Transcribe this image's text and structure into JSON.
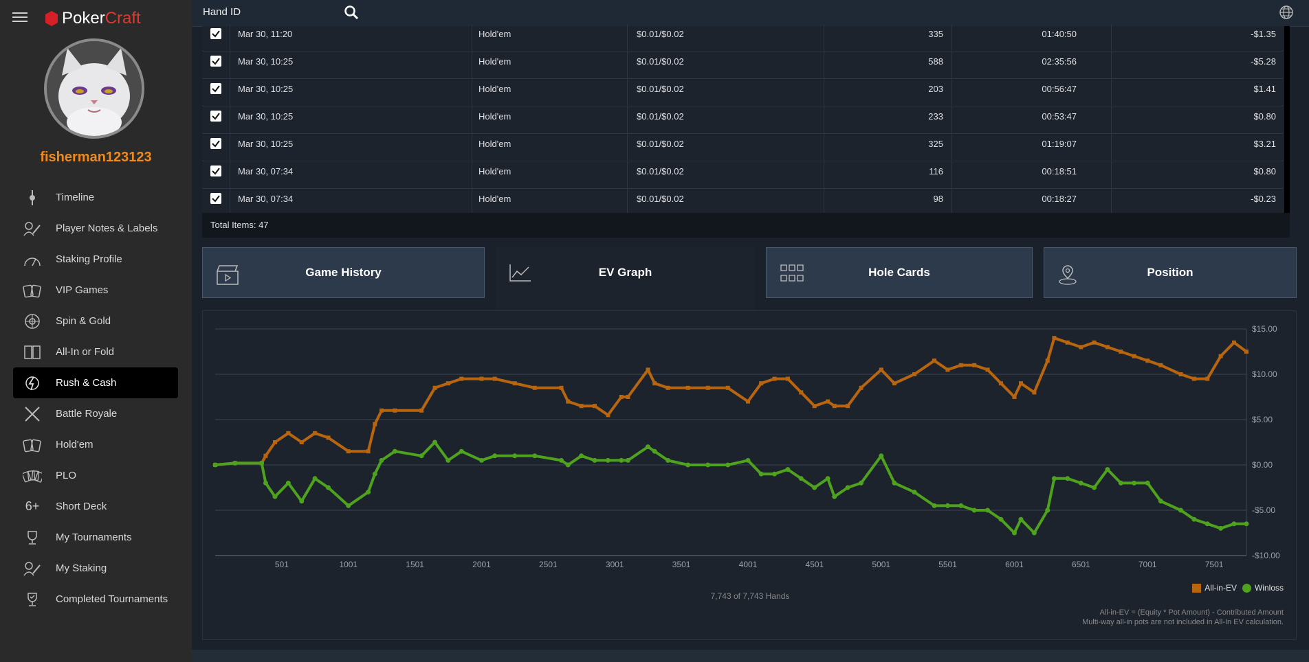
{
  "app": {
    "brand_part1": "Poker",
    "brand_part2": "Craft",
    "username": "fisherman123123"
  },
  "topbar": {
    "hand_id_label": "Hand ID"
  },
  "sidebar": {
    "items": [
      {
        "label": "Timeline",
        "icon": "timeline-icon",
        "active": false
      },
      {
        "label": "Player Notes & Labels",
        "icon": "player-notes-icon",
        "active": false
      },
      {
        "label": "Staking Profile",
        "icon": "staking-profile-icon",
        "active": false
      },
      {
        "label": "VIP Games",
        "icon": "vip-cards-icon",
        "active": false
      },
      {
        "label": "Spin & Gold",
        "icon": "spin-gold-icon",
        "active": false
      },
      {
        "label": "All-In or Fold",
        "icon": "allin-fold-icon",
        "active": false
      },
      {
        "label": "Rush & Cash",
        "icon": "rush-cash-icon",
        "active": true
      },
      {
        "label": "Battle Royale",
        "icon": "battle-royale-icon",
        "active": false
      },
      {
        "label": "Hold'em",
        "icon": "holdem-cards-icon",
        "active": false
      },
      {
        "label": "PLO",
        "icon": "plo-cards-icon",
        "active": false
      },
      {
        "label": "Short Deck",
        "icon": "short-deck-icon",
        "active": false
      },
      {
        "label": "My Tournaments",
        "icon": "trophy-icon",
        "active": false
      },
      {
        "label": "My Staking",
        "icon": "my-staking-icon",
        "active": false
      },
      {
        "label": "Completed Tournaments",
        "icon": "completed-trophy-icon",
        "active": false
      }
    ]
  },
  "table": {
    "rows": [
      {
        "date": "Mar 30, 11:20",
        "game": "Hold'em",
        "stakes": "$0.01/$0.02",
        "hands": "335",
        "duration": "01:40:50",
        "result": "-$1.35"
      },
      {
        "date": "Mar 30, 10:25",
        "game": "Hold'em",
        "stakes": "$0.01/$0.02",
        "hands": "588",
        "duration": "02:35:56",
        "result": "-$5.28"
      },
      {
        "date": "Mar 30, 10:25",
        "game": "Hold'em",
        "stakes": "$0.01/$0.02",
        "hands": "203",
        "duration": "00:56:47",
        "result": "$1.41"
      },
      {
        "date": "Mar 30, 10:25",
        "game": "Hold'em",
        "stakes": "$0.01/$0.02",
        "hands": "233",
        "duration": "00:53:47",
        "result": "$0.80"
      },
      {
        "date": "Mar 30, 10:25",
        "game": "Hold'em",
        "stakes": "$0.01/$0.02",
        "hands": "325",
        "duration": "01:19:07",
        "result": "$3.21"
      },
      {
        "date": "Mar 30, 07:34",
        "game": "Hold'em",
        "stakes": "$0.01/$0.02",
        "hands": "116",
        "duration": "00:18:51",
        "result": "$0.80"
      },
      {
        "date": "Mar 30, 07:34",
        "game": "Hold'em",
        "stakes": "$0.01/$0.02",
        "hands": "98",
        "duration": "00:18:27",
        "result": "-$0.23"
      }
    ],
    "total_items": "Total Items: 47"
  },
  "tabs": [
    {
      "label": "Game History",
      "icon": "game-history-icon",
      "active": false
    },
    {
      "label": "EV Graph",
      "icon": "ev-graph-icon",
      "active": true
    },
    {
      "label": "Hole Cards",
      "icon": "hole-cards-grid-icon",
      "active": false
    },
    {
      "label": "Position",
      "icon": "position-pin-icon",
      "active": false
    }
  ],
  "graph": {
    "hands_count": "7,743 of 7,743 Hands",
    "footnote_line1": "All-in-EV = (Equity * Pot Amount) - Contributed Amount",
    "footnote_line2": "Multi-way all-in pots are not included in All-In EV calculation."
  },
  "chart_data": {
    "type": "line",
    "xlabel": "",
    "ylabel": "",
    "xlim": [
      1,
      7743
    ],
    "ylim": [
      -10,
      15
    ],
    "x_ticks": [
      "501",
      "1001",
      "1501",
      "2001",
      "2501",
      "3001",
      "3501",
      "4001",
      "4501",
      "5001",
      "5501",
      "6001",
      "6501",
      "7001",
      "7501"
    ],
    "x_tick_values": [
      501,
      1001,
      1501,
      2001,
      2501,
      3001,
      3501,
      4001,
      4501,
      5001,
      5501,
      6001,
      6501,
      7001,
      7501
    ],
    "y_ticks": [
      "$15.00",
      "$10.00",
      "$5.00",
      "$0.00",
      "-$5.00",
      "-$10.00"
    ],
    "y_tick_values": [
      15,
      10,
      5,
      0,
      -5,
      -10
    ],
    "grid": true,
    "legend_position": "bottom-right",
    "series": [
      {
        "name": "All-in-EV",
        "color": "#b8650f",
        "x": [
          1,
          150,
          350,
          380,
          450,
          550,
          650,
          750,
          850,
          1001,
          1150,
          1200,
          1250,
          1350,
          1550,
          1650,
          1750,
          1850,
          2001,
          2100,
          2250,
          2400,
          2600,
          2650,
          2750,
          2850,
          2950,
          3050,
          3100,
          3250,
          3300,
          3400,
          3550,
          3700,
          3850,
          4001,
          4100,
          4200,
          4300,
          4400,
          4500,
          4600,
          4650,
          4750,
          4850,
          5001,
          5100,
          5250,
          5400,
          5500,
          5600,
          5700,
          5800,
          5900,
          6001,
          6050,
          6150,
          6250,
          6300,
          6400,
          6500,
          6600,
          6700,
          6800,
          6900,
          7001,
          7100,
          7250,
          7350,
          7450,
          7550,
          7650,
          7743
        ],
        "y": [
          0,
          0.2,
          0.2,
          1,
          2.5,
          3.5,
          2.5,
          3.5,
          3,
          1.5,
          1.5,
          4.5,
          6,
          6,
          6,
          8.5,
          9,
          9.5,
          9.5,
          9.5,
          9,
          8.5,
          8.5,
          7,
          6.5,
          6.5,
          5.5,
          7.5,
          7.5,
          10.5,
          9,
          8.5,
          8.5,
          8.5,
          8.5,
          7,
          9,
          9.5,
          9.5,
          8,
          6.5,
          7,
          6.5,
          6.5,
          8.5,
          10.5,
          9,
          10,
          11.5,
          10.5,
          11,
          11,
          10.5,
          9,
          7.5,
          9,
          8,
          11.5,
          14,
          13.5,
          13,
          13.5,
          13,
          12.5,
          12,
          11.5,
          11,
          10,
          9.5,
          9.5,
          12,
          13.5,
          12.5
        ]
      },
      {
        "name": "Winloss",
        "color": "#4ea21e",
        "x": [
          1,
          150,
          350,
          380,
          450,
          550,
          650,
          750,
          850,
          1001,
          1150,
          1200,
          1250,
          1350,
          1550,
          1650,
          1750,
          1850,
          2001,
          2100,
          2250,
          2400,
          2600,
          2650,
          2750,
          2850,
          2950,
          3050,
          3100,
          3250,
          3300,
          3400,
          3550,
          3700,
          3850,
          4001,
          4100,
          4200,
          4300,
          4400,
          4500,
          4600,
          4650,
          4750,
          4850,
          5001,
          5100,
          5250,
          5400,
          5500,
          5600,
          5700,
          5800,
          5900,
          6001,
          6050,
          6150,
          6250,
          6300,
          6400,
          6500,
          6600,
          6700,
          6800,
          6900,
          7001,
          7100,
          7250,
          7350,
          7450,
          7550,
          7650,
          7743
        ],
        "y": [
          0,
          0.2,
          0.2,
          -2,
          -3.5,
          -2,
          -4,
          -1.5,
          -2.5,
          -4.5,
          -3,
          -1,
          0.5,
          1.5,
          1,
          2.5,
          0.5,
          1.5,
          0.5,
          1,
          1,
          1,
          0.5,
          0,
          1,
          0.5,
          0.5,
          0.5,
          0.5,
          2,
          1.5,
          0.5,
          0,
          0,
          0,
          0.5,
          -1,
          -1,
          -0.5,
          -1.5,
          -2.5,
          -1.5,
          -3.5,
          -2.5,
          -2,
          1,
          -2,
          -3,
          -4.5,
          -4.5,
          -4.5,
          -5,
          -5,
          -6,
          -7.5,
          -6,
          -7.5,
          -5,
          -1.5,
          -1.5,
          -2,
          -2.5,
          -0.5,
          -2,
          -2,
          -2,
          -4,
          -5,
          -6,
          -6.5,
          -7,
          -6.5,
          -6.5
        ]
      }
    ]
  }
}
